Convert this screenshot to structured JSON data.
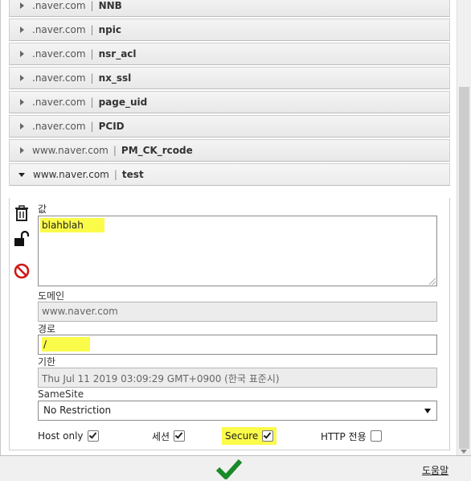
{
  "cookies": [
    {
      "domain": ".naver.com",
      "name": "NNB"
    },
    {
      "domain": ".naver.com",
      "name": "npic"
    },
    {
      "domain": ".naver.com",
      "name": "nsr_acl"
    },
    {
      "domain": ".naver.com",
      "name": "nx_ssl"
    },
    {
      "domain": ".naver.com",
      "name": "page_uid"
    },
    {
      "domain": ".naver.com",
      "name": "PCID"
    },
    {
      "domain": "www.naver.com",
      "name": "PM_CK_rcode"
    },
    {
      "domain": "www.naver.com",
      "name": "test"
    }
  ],
  "separator": "|",
  "detail": {
    "value_label": "값",
    "value": "blahblah",
    "domain_label": "도메인",
    "domain": "www.naver.com",
    "path_label": "경로",
    "path": "/",
    "expiry_label": "기한",
    "expiry": "Thu Jul 11 2019 03:09:29 GMT+0900 (한국 표준시)",
    "samesite_label": "SameSite",
    "samesite": "No Restriction",
    "host_only_label": "Host only",
    "host_only": true,
    "session_label": "세션",
    "session": true,
    "secure_label": "Secure",
    "secure": true,
    "http_only_label": "HTTP 전용",
    "http_only": false
  },
  "icons": [
    "trash-icon",
    "unlock-icon",
    "block-icon",
    "checkmark-icon"
  ],
  "colors": {
    "highlight": "#fbfb4a",
    "check_green": "#1a8a2a",
    "block_red": "#d01818"
  },
  "footer": {
    "help_label": "도움말"
  }
}
